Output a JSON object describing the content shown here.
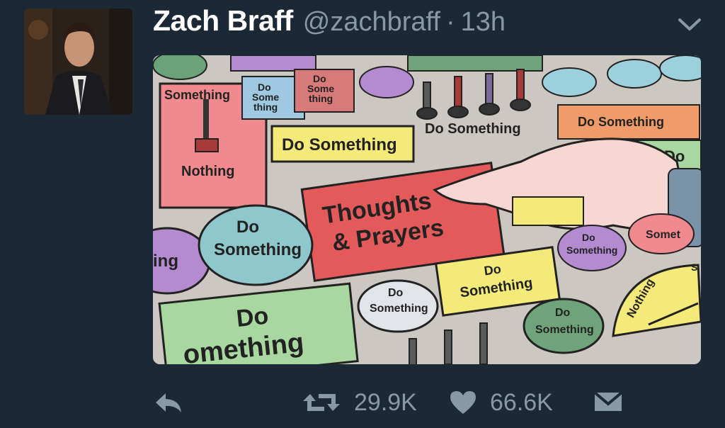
{
  "tweet": {
    "display_name": "Zach Braff",
    "handle": "@zachbraff",
    "separator": "·",
    "time": "13h"
  },
  "media": {
    "buttons": {
      "something": "Something",
      "nothing": "Nothing",
      "do": "Do",
      "some": "Some",
      "thing": "thing",
      "do_something": "Do Something",
      "thoughts": "Thoughts",
      "and_prayers": "& Prayers",
      "something_big_partial": "omething",
      "ing_partial": "ing",
      "some_partial": "Somet",
      "so_partial": "So",
      "s_partial": "S"
    }
  },
  "actions": {
    "retweet_count": "29.9K",
    "like_count": "66.6K"
  },
  "colors": {
    "background": "#1b2836",
    "secondary_text": "#8899a6"
  },
  "icons": [
    "chevron-down-icon",
    "reply-icon",
    "retweet-icon",
    "heart-icon",
    "direct-message-icon"
  ]
}
